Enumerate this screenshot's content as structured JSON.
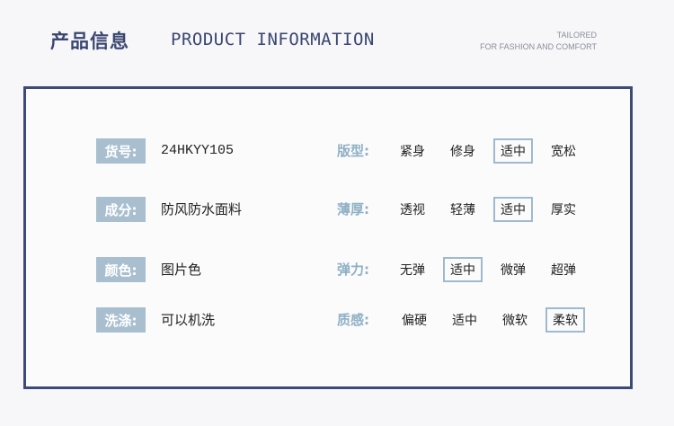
{
  "header": {
    "title_cn": "产品信息",
    "title_en": "PRODUCT INFORMATION",
    "tag_line1": "TAILORED",
    "tag_line2": "FOR FASHION AND COMFORT"
  },
  "rows": [
    {
      "label": "货号:",
      "value": "24HKYY105",
      "attr": "版型:",
      "options": [
        "紧身",
        "修身",
        "适中",
        "宽松"
      ],
      "selected": 2
    },
    {
      "label": "成分:",
      "value": "防风防水面料",
      "attr": "薄厚:",
      "options": [
        "透视",
        "轻薄",
        "适中",
        "厚实"
      ],
      "selected": 2
    },
    {
      "label": "颜色:",
      "value": "图片色",
      "attr": "弹力:",
      "options": [
        "无弹",
        "适中",
        "微弹",
        "超弹"
      ],
      "selected": 1
    },
    {
      "label": "洗涤:",
      "value": "可以机洗",
      "attr": "质感:",
      "options": [
        "偏硬",
        "适中",
        "微软",
        "柔软"
      ],
      "selected": 3
    }
  ],
  "colors": {
    "title": "#3a4670",
    "border": "#3d4a78",
    "label_bg": "#a9bfcf",
    "attr_text": "#8fb0c4",
    "selected_border": "#9fbad0"
  }
}
